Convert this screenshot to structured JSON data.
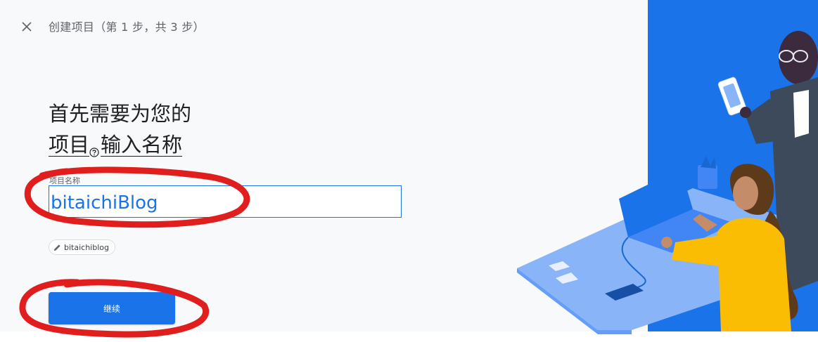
{
  "header": {
    "close_icon": "close-icon",
    "step_title": "创建项目（第 1 步，共 3 步）"
  },
  "main": {
    "heading_line1": "首先需要为您的",
    "heading_project_link": "项目",
    "heading_line2_rest": "输入名称",
    "help_icon": "question-circle-icon"
  },
  "form": {
    "project_name_label": "项目名称",
    "project_name_value": "bitaichiBlog",
    "project_id_chip": "bitaichiblog",
    "edit_icon": "pencil-icon",
    "continue_label": "继续"
  },
  "colors": {
    "accent": "#1a73e8",
    "annotation": "#e01e1e",
    "illustration_bg": "#1a73e8"
  }
}
